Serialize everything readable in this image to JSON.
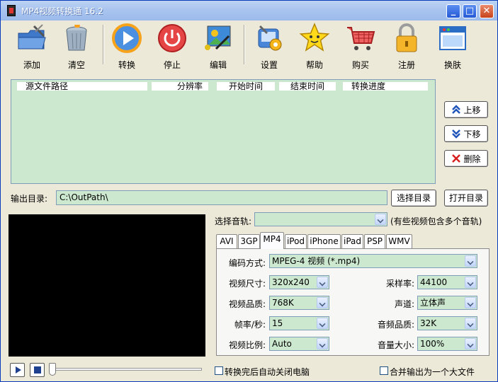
{
  "window": {
    "title": "MP4视频转换通 16.2",
    "minimize": "_",
    "maximize": "□",
    "close": "✕"
  },
  "toolbar": {
    "items": [
      {
        "label": "添加",
        "icon": "folder-add-icon"
      },
      {
        "label": "清空",
        "icon": "trash-can-icon"
      },
      {
        "label": "转换",
        "icon": "play-circle-icon"
      },
      {
        "label": "停止",
        "icon": "power-stop-icon"
      },
      {
        "label": "编辑",
        "icon": "edit-image-icon"
      },
      {
        "label": "设置",
        "icon": "settings-tools-icon"
      },
      {
        "label": "帮助",
        "icon": "star-help-icon"
      },
      {
        "label": "购买",
        "icon": "shopping-cart-icon"
      },
      {
        "label": "注册",
        "icon": "lock-icon"
      },
      {
        "label": "换肤",
        "icon": "window-skin-icon"
      }
    ]
  },
  "file_list": {
    "columns": [
      "源文件路径",
      "分辨率",
      "开始时间",
      "结束时间",
      "转换进度"
    ]
  },
  "side_buttons": {
    "move_up": "上移",
    "move_down": "下移",
    "delete": "删除"
  },
  "output": {
    "label": "输出目录:",
    "path": "C:\\OutPath\\",
    "choose_dir": "选择目录",
    "open_dir": "打开目录"
  },
  "audio": {
    "label": "选择音轨:",
    "value": "",
    "note": "(有些视频包含多个音轨)"
  },
  "tabs": [
    {
      "label": "AVI",
      "active": false
    },
    {
      "label": "3GP",
      "active": false
    },
    {
      "label": "MP4",
      "active": true
    },
    {
      "label": "iPod",
      "active": false
    },
    {
      "label": "iPhone",
      "active": false
    },
    {
      "label": "iPad",
      "active": false
    },
    {
      "label": "PSP",
      "active": false
    },
    {
      "label": "WMV",
      "active": false
    }
  ],
  "settings": {
    "codec_label": "编码方式:",
    "codec_value": "MPEG-4 视频 (*.mp4)",
    "size_label": "视频尺寸:",
    "size_value": "320x240",
    "quality_label": "视频品质:",
    "quality_value": "768K",
    "fps_label": "帧率/秒:",
    "fps_value": "15",
    "aspect_label": "视频比例:",
    "aspect_value": "Auto",
    "samplerate_label": "采样率:",
    "samplerate_value": "44100",
    "channel_label": "声道:",
    "channel_value": "立体声",
    "audio_quality_label": "音频品质:",
    "audio_quality_value": "32K",
    "volume_label": "音量大小:",
    "volume_value": "100%"
  },
  "options": {
    "shutdown_label": "转换完后自动关闭电脑",
    "shutdown_checked": false,
    "merge_label": "合并输出为一个大文件",
    "merge_checked": false
  },
  "player": {
    "position": 0
  },
  "colors": {
    "titlebar": "#a9c4ee",
    "list_bg": "#cce8cf",
    "window_bg": "#ece9d8",
    "preview_bg": "#000000"
  }
}
